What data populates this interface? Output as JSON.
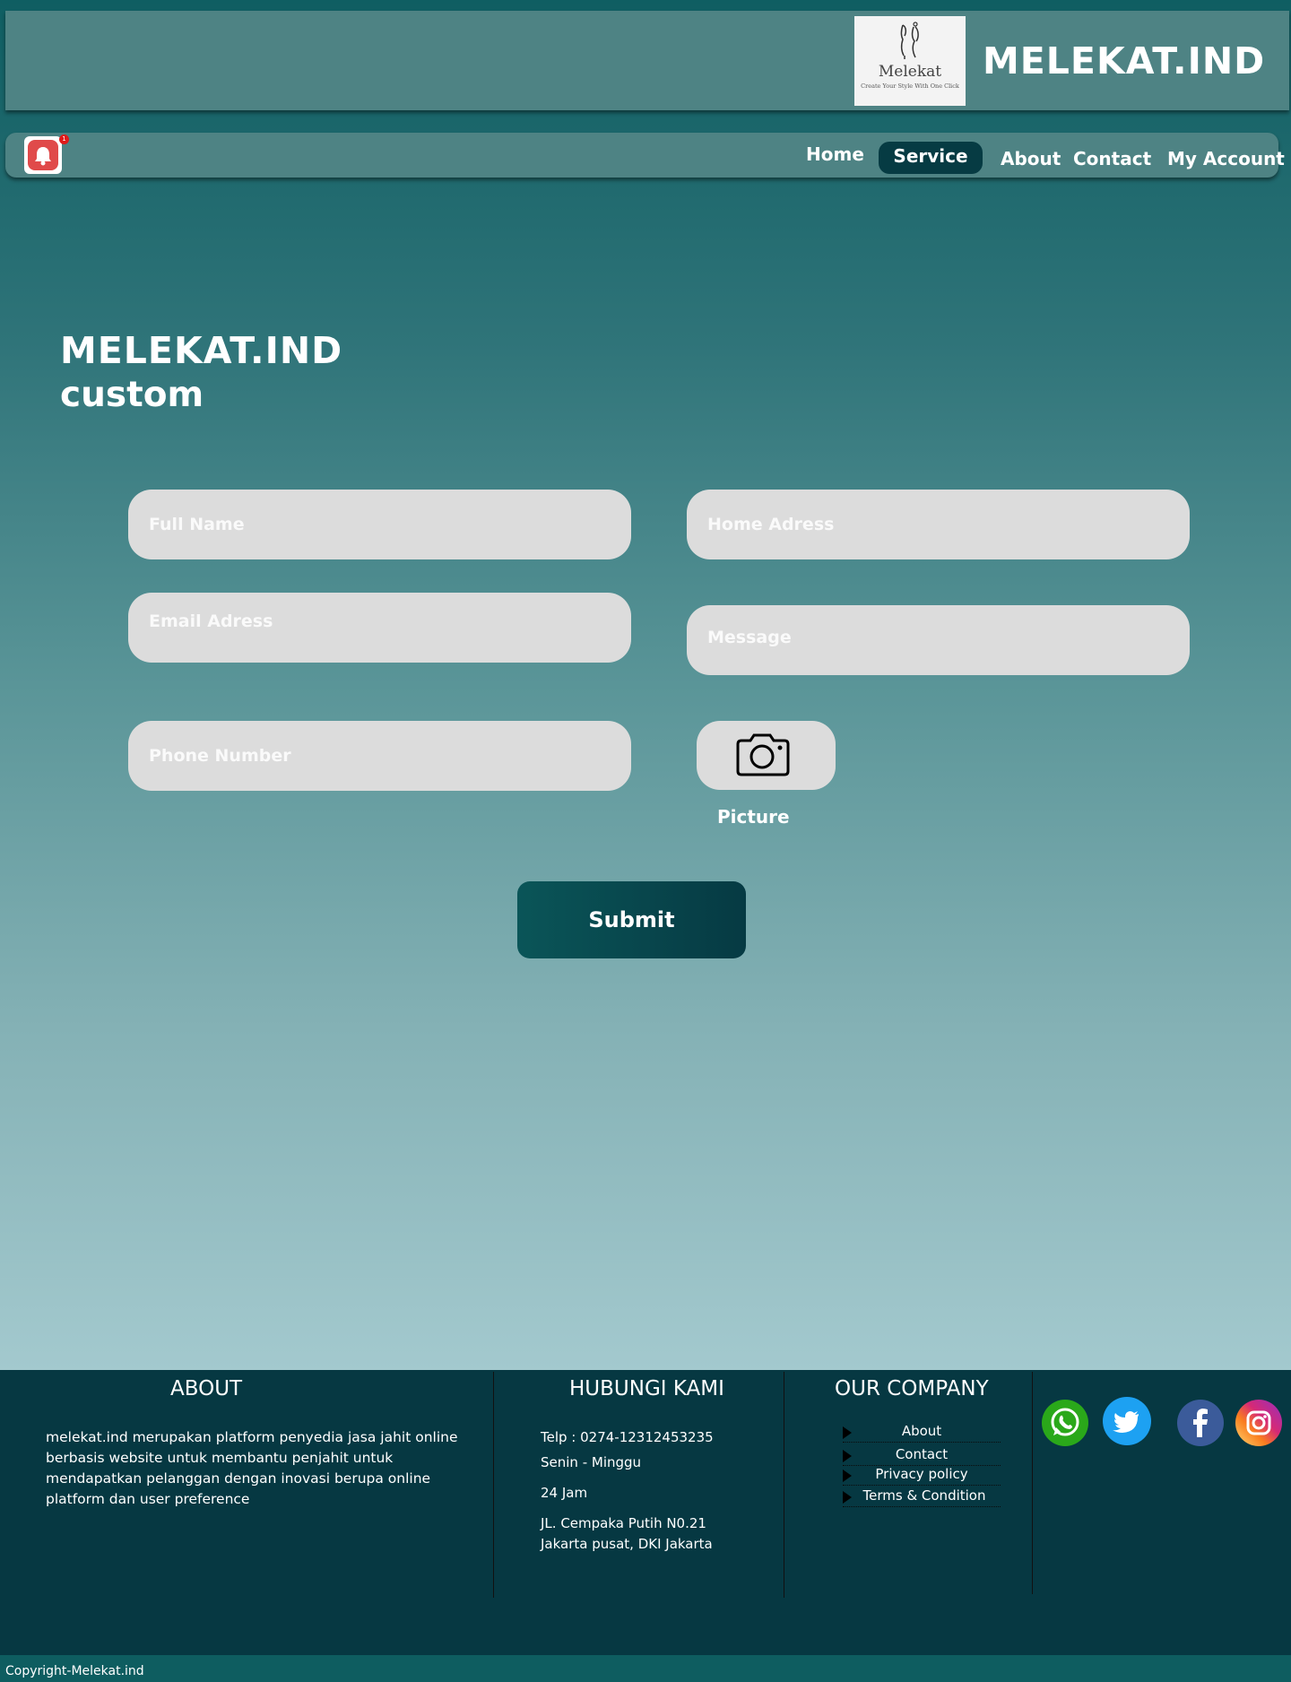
{
  "header": {
    "logo": {
      "name": "Melekat",
      "tagline": "Create Your Style With One Click"
    },
    "brand": "MELEKAT.IND"
  },
  "nav": {
    "notification_count": "1",
    "items": [
      {
        "label": "Home"
      },
      {
        "label": "Service",
        "active": true
      },
      {
        "label": "About"
      },
      {
        "label": "Contact"
      },
      {
        "label": "My Account"
      }
    ]
  },
  "main": {
    "title": "MELEKAT.IND",
    "subtitle": "custom",
    "form": {
      "full_name_placeholder": "Full Name",
      "home_address_placeholder": "Home Adress",
      "email_placeholder": "Email Adress",
      "message_placeholder": "Message",
      "phone_placeholder": "Phone Number",
      "picture_label": "Picture",
      "submit_label": "Submit"
    }
  },
  "footer": {
    "about": {
      "heading": "ABOUT",
      "text": "melekat.ind merupakan platform penyedia jasa jahit online berbasis website untuk membantu penjahit untuk mendapatkan pelanggan dengan inovasi berupa online platform dan user preference"
    },
    "contact": {
      "heading": "HUBUNGI KAMI",
      "phone": "Telp  :  0274-12312453235",
      "days": "Senin - Minggu",
      "hours": "24 Jam",
      "address_line1": "JL. Cempaka Putih N0.21",
      "address_line2": "Jakarta pusat, DKI Jakarta"
    },
    "company": {
      "heading": "OUR COMPANY",
      "links": [
        "About",
        "Contact",
        "Privacy policy",
        "Terms & Condition"
      ]
    },
    "social": [
      "whatsapp-icon",
      "twitter-icon",
      "facebook-icon",
      "instagram-icon"
    ],
    "copyright": "Copyright-Melekat.ind"
  },
  "colors": {
    "dark_teal": "#063842",
    "header_teal": "#4e8384",
    "active_nav": "#063b43",
    "field_bg": "#dcdcdc"
  }
}
